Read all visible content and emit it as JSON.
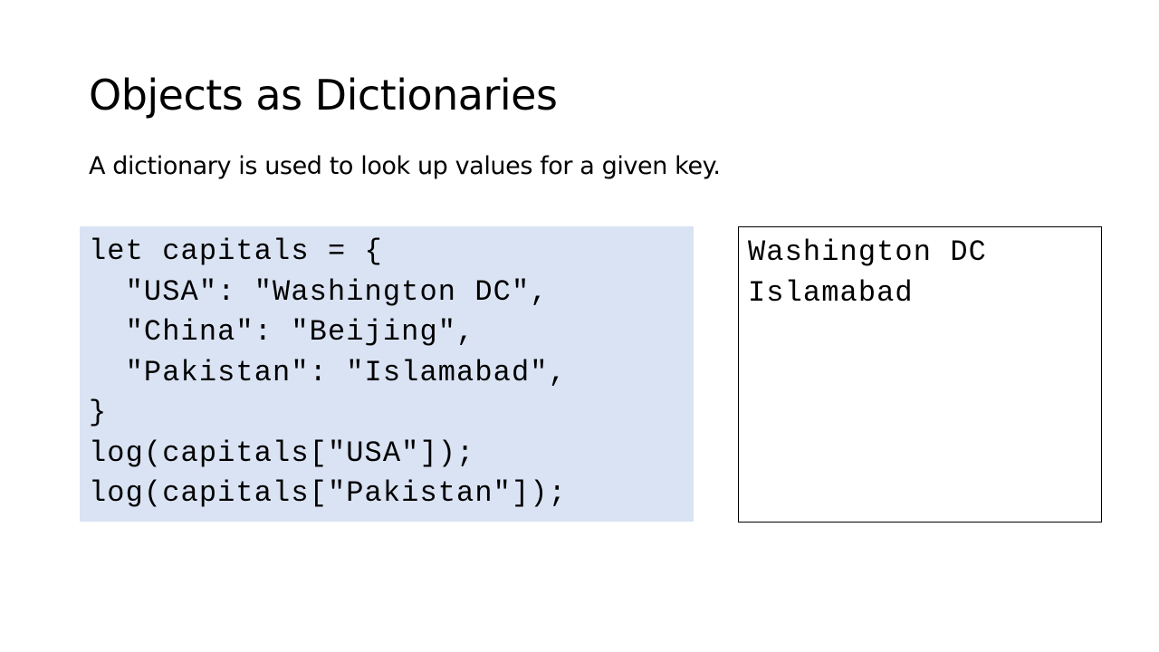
{
  "slide": {
    "title": "Objects as Dictionaries",
    "subtitle": "A dictionary is used to look up values for a given key."
  },
  "code": {
    "lines": [
      "let capitals = {",
      "  \"USA\": \"Washington DC\",",
      "  \"China\": \"Beijing\",",
      "  \"Pakistan\": \"Islamabad\",",
      "}",
      "log(capitals[\"USA\"]);",
      "log(capitals[\"Pakistan\"]);"
    ]
  },
  "output": {
    "lines": [
      "Washington DC",
      "Islamabad"
    ]
  },
  "colors": {
    "code_background": "#dae3f3",
    "output_border": "#000000",
    "text": "#000000"
  }
}
